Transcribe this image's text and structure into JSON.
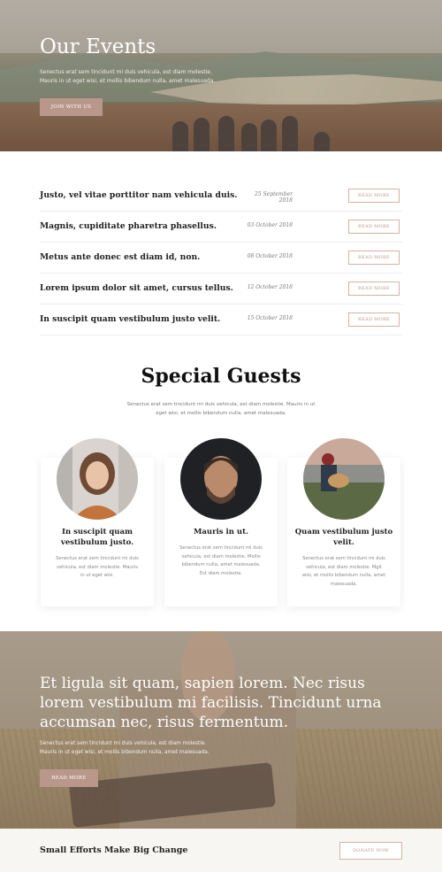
{
  "hero": {
    "title": "Our Events",
    "description": "Senectus erat sem tincidunt mi duis vehicula, est diam molestie. Mauris in ut eget wisi, et mollis bibendum nulla, amet malesuada.",
    "button_label": "JOIN WITH US"
  },
  "events": [
    {
      "title": "Justo, vel vitae porttitor nam vehicula duis.",
      "date": "25 September 2018",
      "button": "READ MORE"
    },
    {
      "title": "Magnis, cupiditate pharetra phasellus.",
      "date": "03 October 2018",
      "button": "READ MORE"
    },
    {
      "title": "Metus ante donec est diam id, non.",
      "date": "08 October 2018",
      "button": "READ MORE"
    },
    {
      "title": "Lorem ipsum dolor sit amet, cursus tellus.",
      "date": "12 October 2018",
      "button": "READ MORE"
    },
    {
      "title": "In suscipit quam vestibulum justo velit.",
      "date": "15 October 2018",
      "button": "READ MORE"
    }
  ],
  "guests": {
    "title": "Special Guests",
    "description": "Senectus erat sem tincidunt mi duis vehicula, est diam molestie. Mauris in ut eget wisi, et mollis bibendum nulla, amet malesuada.",
    "cards": [
      {
        "name": "In suscipit quam vestibulum justo.",
        "text": "Senectus erat sem tincidunt mi duis vehicula, est diam molestie. Mauris in ut eget wisi."
      },
      {
        "name": "Mauris in ut.",
        "text": "Senectus erat sem tincidunt mi duis vehicula, est diam molestie. Mollis bibendum nulla, amet malesuada.  Est diam molestie."
      },
      {
        "name": "Quam vestibulum justo velit.",
        "text": "Senectus erat sem tincidunt mi duis vehicula, est diam molestie. Mgit wisi, et mollis bibendum nulla, amet malesuada."
      }
    ]
  },
  "quote": {
    "heading": "Et ligula sit quam, sapien lorem. Nec risus lorem vestibulum mi facilisis. Tincidunt urna accumsan nec, risus fermentum.",
    "description": "Senectus erat sem tincidunt mi duis vehicula, est diam molestie. Mauris in ut eget wisi, et mollis bibendum nulla, amet malesuada.",
    "button_label": "READ MORE"
  },
  "donate": {
    "label": "Small Efforts Make Big Change",
    "button_label": "DONATE NOW"
  },
  "colors": {
    "accent": "#b9978a",
    "accent_border": "#d3b3a4"
  }
}
